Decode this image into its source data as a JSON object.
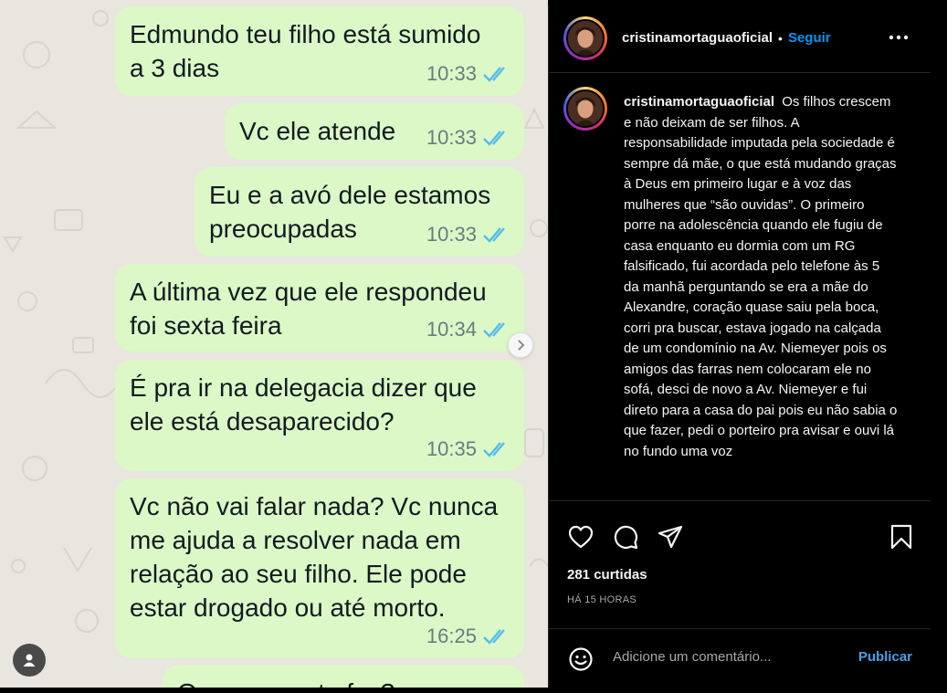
{
  "chat": {
    "messages": [
      {
        "text": "Edmundo teu filho está sumido\na 3 dias",
        "time": "10:33"
      },
      {
        "text": "Vc ele atende",
        "time": "10:33"
      },
      {
        "text": "Eu e a avó dele estamos\npreocupadas",
        "time": "10:33"
      },
      {
        "text": "A última vez que ele respondeu\nfoi sexta feira",
        "time": "10:34"
      },
      {
        "text": "É pra ir na delegacia dizer que\nele está desaparecido?",
        "time": "10:35"
      },
      {
        "text": "Vc não vai falar nada? Vc nunca\nme ajuda a resolver nada em\nrelação ao seu filho. Ele pode\nestar drogado ou até morto.",
        "time": "16:25"
      },
      {
        "text": "O que a gente faz?",
        "time": ""
      }
    ],
    "colors": {
      "bubble": "#dcf8c6",
      "ticks": "#53bdeb",
      "wallpaper": "#e9e5df"
    }
  },
  "instagram": {
    "header": {
      "username": "cristinamortaguaoficial",
      "separator": "•",
      "follow_label": "Seguir",
      "more_icon": "more-horizontal-icon"
    },
    "caption": {
      "username": "cristinamortaguaoficial",
      "text": "Os filhos crescem e não deixam de ser filhos. A responsabilidade imputada pela sociedade é sempre dá mãe, o que está mudando graças à Deus em primeiro lugar e à voz das mulheres que “são ouvidas”. O primeiro porre na adolescência quando ele fugiu de casa enquanto eu dormia com um RG falsificado, fui acordada pelo telefone às 5 da manhã perguntando se era a mãe do Alexandre, coração quase saiu pela boca, corri pra buscar, estava jogado na calçada de um condomínio na Av. Niemeyer pois os amigos das farras nem colocaram ele no sofá, desci de novo a Av. Niemeyer e fui direto para a casa do pai pois eu não sabia o que fazer, pedi o porteiro pra avisar e ouvi lá no fundo uma voz"
    },
    "actions": {
      "icons": [
        "heart-icon",
        "comment-icon",
        "share-icon",
        "bookmark-icon"
      ]
    },
    "likes": "281 curtidas",
    "time_ago": "HÁ 15 HORAS",
    "comment": {
      "placeholder": "Adicione um comentário...",
      "submit_label": "Publicar",
      "emoji_icon": "emoji-icon"
    },
    "colors": {
      "accent": "#0095f6",
      "background": "#000000",
      "text": "#f5f5f5",
      "muted": "#a8a8a8"
    }
  }
}
